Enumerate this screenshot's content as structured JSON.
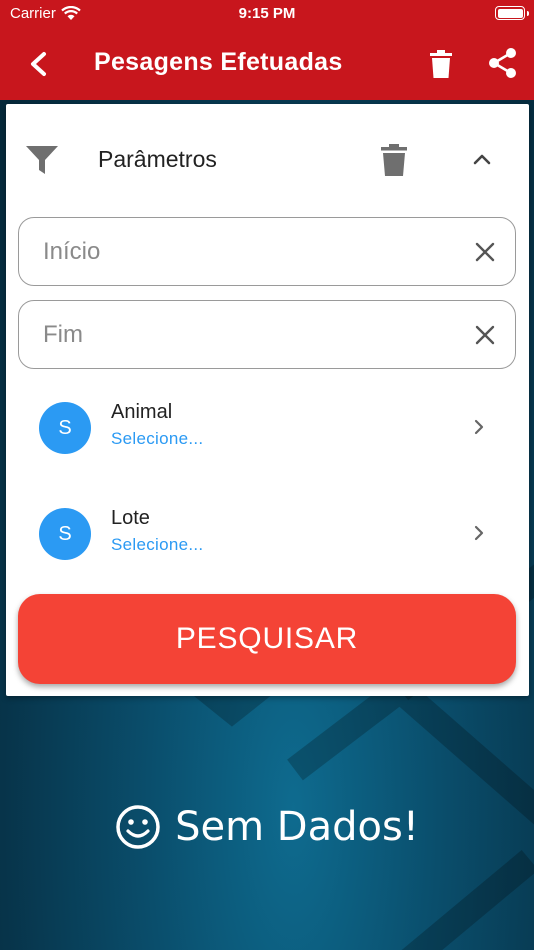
{
  "status_bar": {
    "carrier": "Carrier",
    "time": "9:15 PM"
  },
  "app_bar": {
    "title": "Pesagens Efetuadas",
    "color": "#c8161d"
  },
  "filter_panel": {
    "header_label": "Parâmetros",
    "start_field": {
      "placeholder": "Início",
      "value": ""
    },
    "end_field": {
      "placeholder": "Fim",
      "value": ""
    },
    "items": [
      {
        "avatar": "S",
        "name": "Animal",
        "value": "Selecione..."
      },
      {
        "avatar": "S",
        "name": "Lote",
        "value": "Selecione..."
      }
    ],
    "search_button": "PESQUISAR",
    "accent_color": "#f44336",
    "link_color": "#2b9af3"
  },
  "empty_state": {
    "icon": "smiley-icon",
    "text": "Sem Dados!"
  }
}
